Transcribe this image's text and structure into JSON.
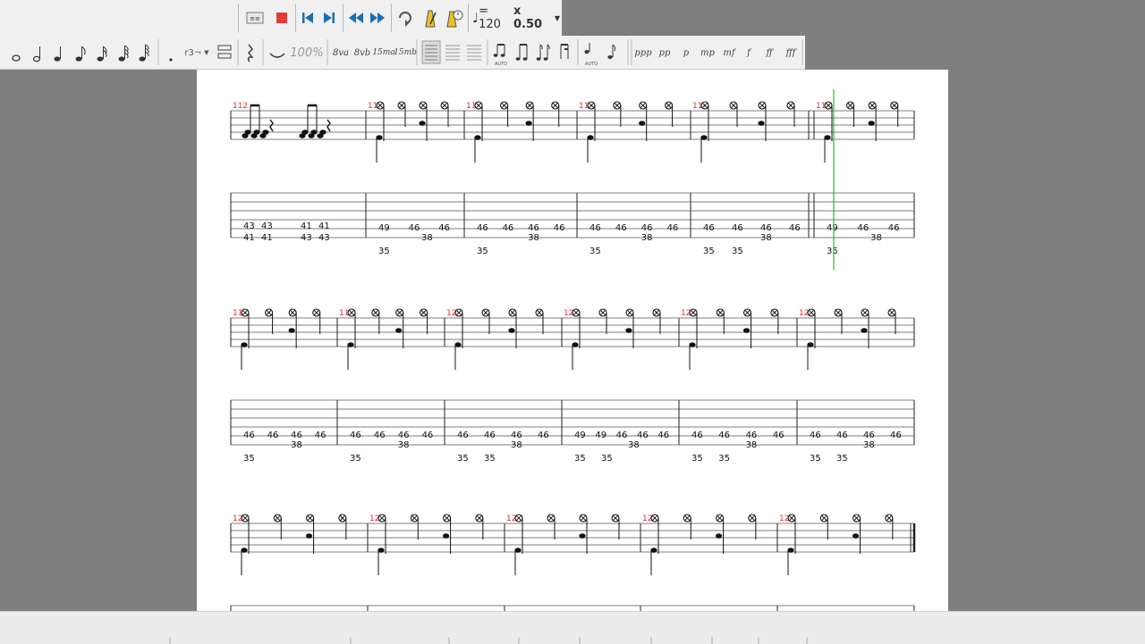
{
  "toolbar_top": {
    "tempo_label": "= 120",
    "speed_label": "x 0.50",
    "buttons": [
      "mixer-icon",
      "stop-icon",
      "first-icon",
      "last-icon",
      "rewind-icon",
      "forward-icon",
      "loop-icon",
      "metronome-icon",
      "count-in-icon"
    ]
  },
  "toolbar_notes": {
    "zoom_label": "100%",
    "ottava": [
      "8va",
      "8vb",
      "15ma",
      "15mb"
    ],
    "dynamics": [
      "ppp",
      "pp",
      "p",
      "mp",
      "mf",
      "f",
      "ff",
      "fff"
    ],
    "tuplet_label": "r3¬"
  },
  "systems": [
    {
      "measures": [
        {
          "number": "112",
          "tab": [
            [
              "43",
              "43",
              "41",
              "41"
            ],
            [
              "41",
              "41",
              "43",
              "43"
            ]
          ]
        },
        {
          "number": "113",
          "tab": [
            [
              "49",
              "46",
              "46"
            ],
            [
              "38"
            ],
            [
              "35"
            ]
          ]
        },
        {
          "number": "114",
          "tab": [
            [
              "46",
              "46",
              "46",
              "46"
            ],
            [
              "38"
            ],
            [
              "35"
            ]
          ]
        },
        {
          "number": "115",
          "tab": [
            [
              "46",
              "46",
              "46",
              "46"
            ],
            [
              "38"
            ],
            [
              "35"
            ]
          ]
        },
        {
          "number": "116",
          "tab": [
            [
              "46",
              "46",
              "46",
              "46"
            ],
            [
              "38"
            ],
            [
              "35",
              "35"
            ]
          ]
        },
        {
          "number": "117",
          "tab": [
            [
              "49",
              "46",
              "46"
            ],
            [
              "38"
            ],
            [
              "35"
            ]
          ]
        }
      ]
    },
    {
      "measures": [
        {
          "number": "118",
          "tab": [
            [
              "46",
              "46",
              "46",
              "46"
            ],
            [
              "38"
            ],
            [
              "35"
            ]
          ]
        },
        {
          "number": "119",
          "tab": [
            [
              "46",
              "46",
              "46",
              "46"
            ],
            [
              "38"
            ],
            [
              "35"
            ]
          ]
        },
        {
          "number": "120",
          "tab": [
            [
              "46",
              "46",
              "46",
              "46"
            ],
            [
              "38"
            ],
            [
              "35",
              "35"
            ]
          ]
        },
        {
          "number": "121",
          "tab": [
            [
              "49",
              "49",
              "46",
              "46",
              "46"
            ],
            [
              "38"
            ],
            [
              "35",
              "35"
            ]
          ]
        },
        {
          "number": "122",
          "tab": [
            [
              "46",
              "46",
              "46",
              "46"
            ],
            [
              "38"
            ],
            [
              "35",
              "35"
            ]
          ]
        },
        {
          "number": "123",
          "tab": [
            [
              "46",
              "46",
              "46",
              "46"
            ],
            [
              "38"
            ],
            [
              "35",
              "35"
            ]
          ]
        }
      ]
    },
    {
      "measures": [
        {
          "number": "124"
        },
        {
          "number": "125"
        },
        {
          "number": "126"
        },
        {
          "number": "127"
        },
        {
          "number": "128"
        }
      ]
    }
  ],
  "colors": {
    "measure_number": "#e03030",
    "cursor": "#22c022",
    "stop": "#e03c3c",
    "play_blue": "#1a6fb0"
  }
}
